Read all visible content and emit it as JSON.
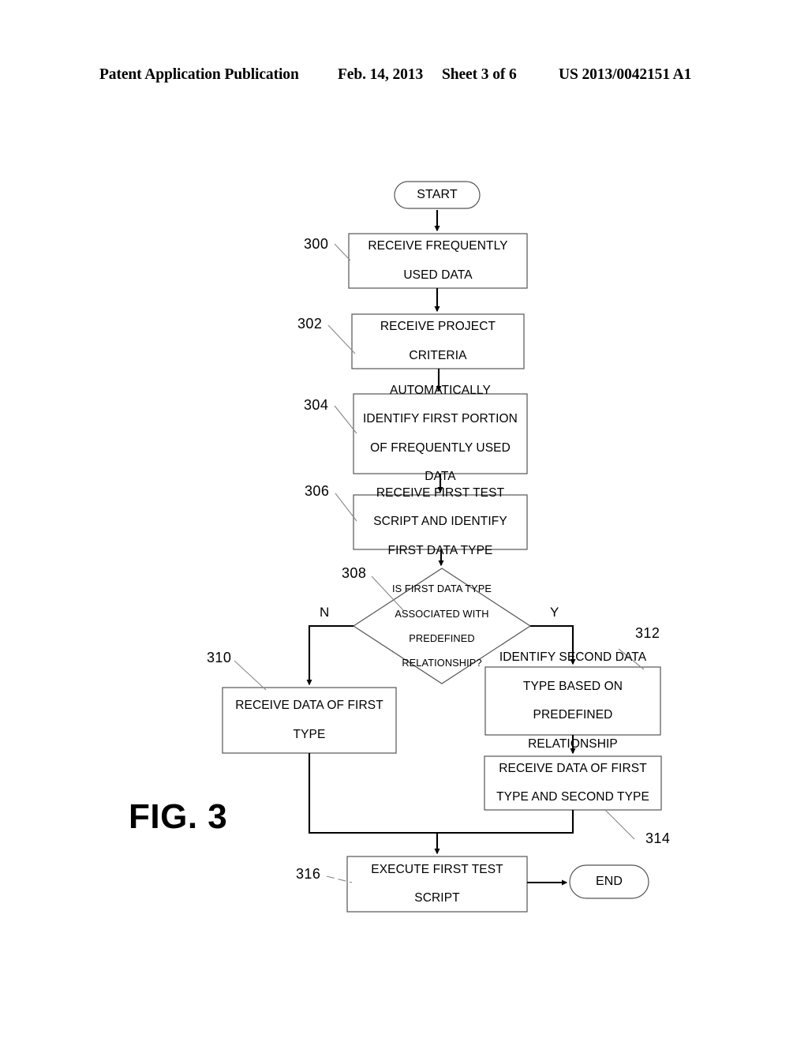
{
  "header": {
    "publication": "Patent Application Publication",
    "date": "Feb. 14, 2013",
    "sheet": "Sheet 3 of 6",
    "doc_id": "US 2013/0042151 A1"
  },
  "figure": {
    "label": "FIG. 3",
    "stroke_color": "#000000",
    "box_border_color": "#555555",
    "leader_color": "#777777"
  },
  "nodes": {
    "start": {
      "ref": "",
      "text": "START",
      "shape": "terminator"
    },
    "n300": {
      "ref": "300",
      "line1": "RECEIVE FREQUENTLY",
      "line2": "USED DATA",
      "shape": "process"
    },
    "n302": {
      "ref": "302",
      "line1": "RECEIVE PROJECT",
      "line2": "CRITERIA",
      "shape": "process"
    },
    "n304": {
      "ref": "304",
      "line1": "AUTOMATICALLY",
      "line2": "IDENTIFY FIRST PORTION",
      "line3": "OF FREQUENTLY USED",
      "line4": "DATA",
      "shape": "process"
    },
    "n306": {
      "ref": "306",
      "line1": "RECEIVE FIRST TEST",
      "line2": "SCRIPT AND IDENTIFY",
      "line3": "FIRST DATA TYPE",
      "shape": "process"
    },
    "n308": {
      "ref": "308",
      "line1": "IS FIRST DATA TYPE",
      "line2": "ASSOCIATED WITH",
      "line3": "PREDEFINED",
      "line4": "RELATIONSHIP?",
      "shape": "decision",
      "branch_no": "N",
      "branch_yes": "Y"
    },
    "n310": {
      "ref": "310",
      "line1": "RECEIVE DATA OF FIRST",
      "line2": "TYPE",
      "shape": "process"
    },
    "n312": {
      "ref": "312",
      "line1": "IDENTIFY SECOND DATA",
      "line2": "TYPE BASED ON",
      "line3": "PREDEFINED",
      "line4": "RELATIONSHIP",
      "shape": "process"
    },
    "n314": {
      "ref": "314",
      "line1": "RECEIVE DATA OF FIRST",
      "line2": "TYPE AND SECOND TYPE",
      "shape": "process"
    },
    "n316": {
      "ref": "316",
      "line1": "EXECUTE FIRST TEST",
      "line2": "SCRIPT",
      "shape": "process"
    },
    "end": {
      "ref": "",
      "text": "END",
      "shape": "terminator"
    }
  }
}
